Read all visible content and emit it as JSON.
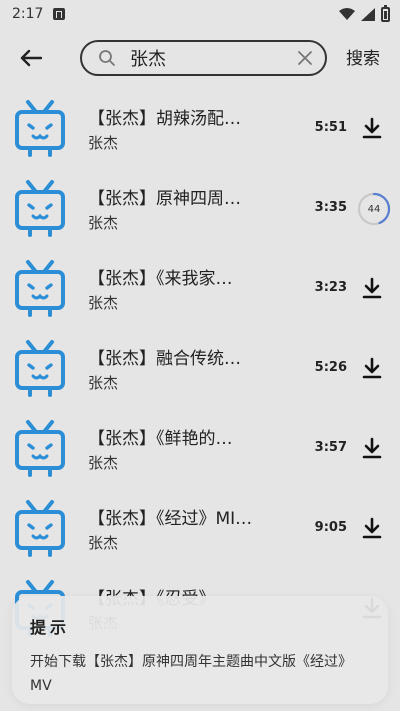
{
  "status_bar": {
    "time": "2:17"
  },
  "search": {
    "query": "张杰",
    "button_label": "搜索"
  },
  "results": [
    {
      "title": "【张杰】胡辣汤配…",
      "artist": "张杰",
      "duration": "5:51",
      "action": "download"
    },
    {
      "title": "【张杰】原神四周…",
      "artist": "张杰",
      "duration": "3:35",
      "action": "progress",
      "progress": 44
    },
    {
      "title": "【张杰】《来我家…",
      "artist": "张杰",
      "duration": "3:23",
      "action": "download"
    },
    {
      "title": "【张杰】融合传统…",
      "artist": "张杰",
      "duration": "5:26",
      "action": "download"
    },
    {
      "title": "【张杰】《鲜艳的…",
      "artist": "张杰",
      "duration": "3:57",
      "action": "download"
    },
    {
      "title": "【张杰】《经过》MI…",
      "artist": "张杰",
      "duration": "9:05",
      "action": "download"
    },
    {
      "title": "【张杰】《忍受》",
      "artist": "张杰",
      "duration": "",
      "action": "download"
    }
  ],
  "toast": {
    "title": "提示",
    "message": "开始下载【张杰】原神四周年主题曲中文版《经过》MV"
  },
  "colors": {
    "accent": "#2c8fd6",
    "background": "#e5e5e5",
    "progress_arc": "#5a7fd1"
  }
}
